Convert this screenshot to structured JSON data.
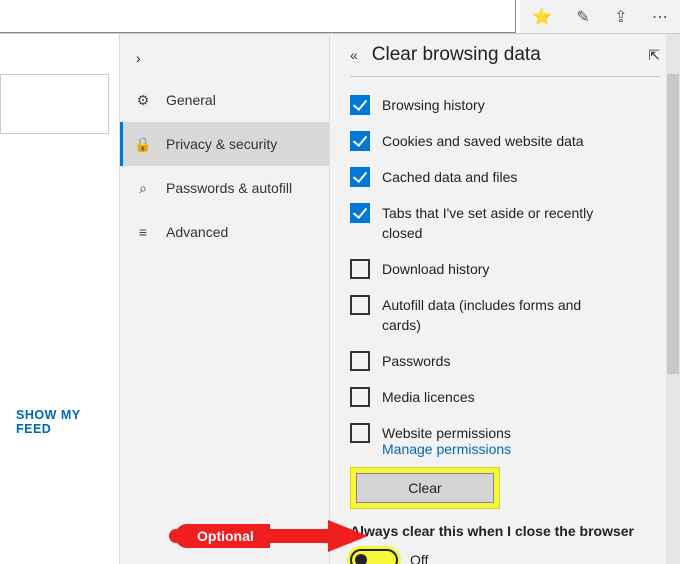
{
  "topbar": {
    "icons": {
      "favorites": "⭐",
      "ink": "✎",
      "share": "⇪",
      "more": "⋯"
    }
  },
  "left": {
    "show_feed": "SHOW MY FEED"
  },
  "settings_nav": {
    "back_glyph": "›",
    "items": [
      {
        "icon": "⚙",
        "label": "General"
      },
      {
        "icon": "🔒",
        "label": "Privacy & security",
        "selected": true
      },
      {
        "icon": "⌕",
        "label": "Passwords & autofill"
      },
      {
        "icon": "≡",
        "label": "Advanced"
      }
    ]
  },
  "panel": {
    "back_glyph": "«",
    "title": "Clear browsing data",
    "pin_glyph": "⇱",
    "items": [
      {
        "label": "Browsing history",
        "checked": true
      },
      {
        "label": "Cookies and saved website data",
        "checked": true
      },
      {
        "label": "Cached data and files",
        "checked": true
      },
      {
        "label": "Tabs that I've set aside or recently closed",
        "checked": true
      },
      {
        "label": "Download history",
        "checked": false
      },
      {
        "label": "Autofill data (includes forms and cards)",
        "checked": false
      },
      {
        "label": "Passwords",
        "checked": false
      },
      {
        "label": "Media licences",
        "checked": false
      },
      {
        "label": "Website permissions",
        "checked": false
      }
    ],
    "manage_link": "Manage permissions",
    "clear_button": "Clear",
    "always_label": "Always clear this when I close the browser",
    "toggle_state": "Off"
  },
  "annotation": {
    "text": "Optional"
  }
}
